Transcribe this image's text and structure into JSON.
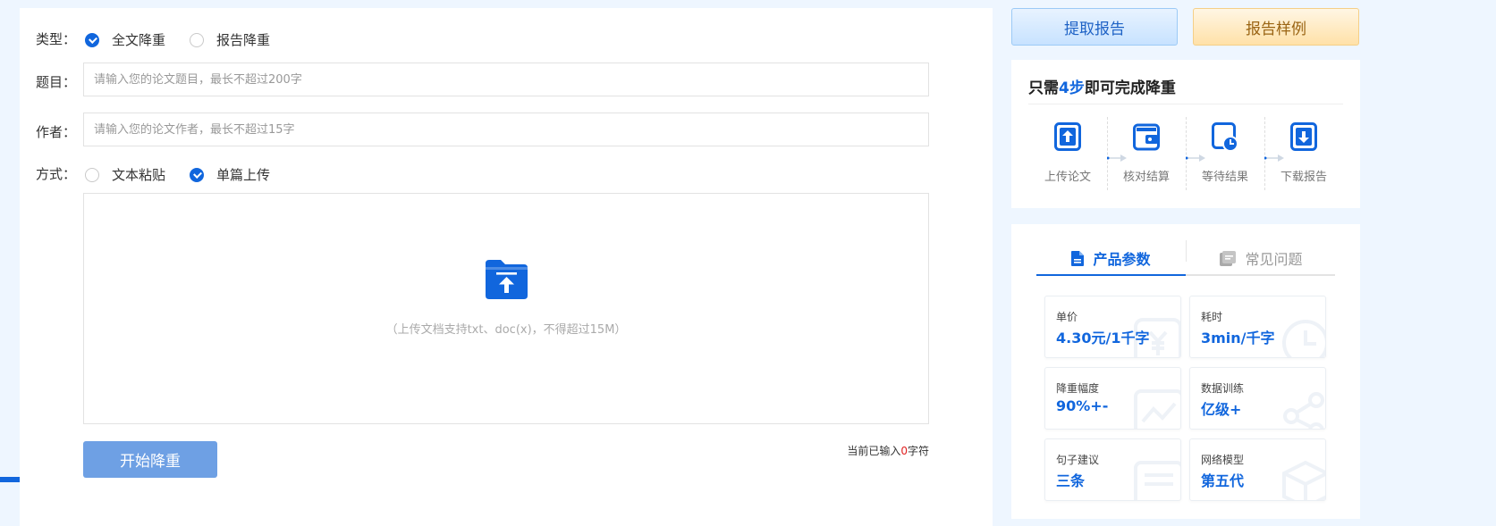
{
  "form": {
    "type_label": "类型：",
    "type_options": [
      {
        "label": "全文降重",
        "checked": true
      },
      {
        "label": "报告降重",
        "checked": false
      }
    ],
    "title_label": "题目：",
    "title_placeholder": "请输入您的论文题目，最长不超过200字",
    "title_value": "",
    "author_label": "作者：",
    "author_placeholder": "请输入您的论文作者，最长不超过15字",
    "author_value": "",
    "mode_label": "方式：",
    "mode_options": [
      {
        "label": "文本粘贴",
        "checked": false
      },
      {
        "label": "单篇上传",
        "checked": true
      }
    ],
    "upload_hint": "（上传文档支持txt、doc(x)，不得超过15M）",
    "start_button": "开始降重",
    "char_count_prefix": "当前已输入",
    "char_count_value": "0",
    "char_count_suffix": "字符"
  },
  "actions": {
    "fetch_report": "提取报告",
    "report_sample": "报告样例"
  },
  "steps": {
    "title_prefix": "只需",
    "title_highlight": "4步",
    "title_suffix": "即可完成降重",
    "items": [
      {
        "label": "上传论文",
        "icon": "upload-paper-icon"
      },
      {
        "label": "核对结算",
        "icon": "wallet-icon"
      },
      {
        "label": "等待结果",
        "icon": "clock-icon"
      },
      {
        "label": "下载报告",
        "icon": "download-icon"
      }
    ]
  },
  "params": {
    "tabs": [
      {
        "label": "产品参数",
        "active": true,
        "icon": "document-icon"
      },
      {
        "label": "常见问题",
        "active": false,
        "icon": "question-card-icon"
      }
    ],
    "items": [
      {
        "label": "单价",
        "value": "4.30元/1千字"
      },
      {
        "label": "耗时",
        "value": "3min/千字"
      },
      {
        "label": "降重幅度",
        "value": "90%+-"
      },
      {
        "label": "数据训练",
        "value": "亿级+"
      },
      {
        "label": "句子建议",
        "value": "三条"
      },
      {
        "label": "网络模型",
        "value": "第五代"
      }
    ]
  },
  "colors": {
    "accent": "#1166dd",
    "page_bg": "#eef6ff",
    "start_button": "#6ea0e4",
    "count_highlight": "#e02020"
  }
}
